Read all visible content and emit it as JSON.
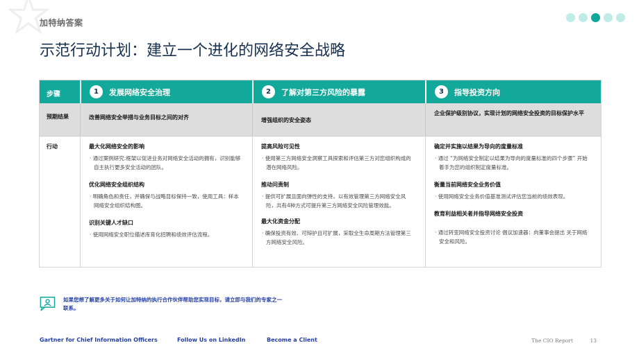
{
  "header": {
    "brand": "加特纳答案",
    "title": "示范行动计划：建立一个进化的网络安全战略",
    "nav_dots": 5,
    "active_dot": 2
  },
  "table": {
    "first_col_header": "步骤",
    "steps": [
      {
        "number": "1",
        "label": "发展网络安全治理"
      },
      {
        "number": "2",
        "label": "了解对第三方风险的暴露"
      },
      {
        "number": "3",
        "label": "指导投资方向"
      }
    ],
    "results_label": "预期结果",
    "results": [
      "改善网络安全举措与业务目标之间的对齐",
      "增强组织的安全姿态",
      "企业保护级别协议，实现计划的网络安全投资的目标保护水平"
    ],
    "actions_label": "行动",
    "actions": [
      {
        "items": [
          {
            "head": "最大化网络安全的影响",
            "body": "· 通过案例研究:框架以促进业务对网络安全活动的拥有，识别能够自主执行更多安全活动的团队。"
          },
          {
            "head": "优化网络安全组织结构",
            "body": "· 明确角色和责任，并确保与战略目标保持一致，使用工具：样本网络安全组织结构图。"
          },
          {
            "head": "识别关键人才缺口",
            "body": "· 使用网络安全职位描述库育化招聘和绩效评估流程。"
          }
        ]
      },
      {
        "items": [
          {
            "head": "提高风险可见性",
            "body": "· 使用第三方网络安全洞察工具探索和评估第三方对您组织构成的潜在网络风险。"
          },
          {
            "head": "推动问责制",
            "body": "· 提供可扩展且面向弹性的支持，以有效管理第三方网络安全风险，共有4种方式可提升第三方网络安全风险管理效能。"
          },
          {
            "head": "最大化资金分配",
            "body": "· 确保投资有效、可辩护且可扩展，采取全生命周期方法管理第三方网络安全风险。"
          }
        ]
      },
      {
        "items": [
          {
            "head": "确定并实施以结果为导向的度量标准",
            "body": "· 通过 “为网络安全制定以结果为导向的度量标准的四个步骤” 开始着手为您的组织制定度量标准。"
          },
          {
            "head": "衡量当前网络安全业务价值",
            "body": "· 使用网络安全业务价值基准测试评估您当前的绩效表现。"
          },
          {
            "head": "教育利益相关者并指导网络安全投资",
            "body": "· 通过转变网络安全投资讨论 倡议加速器：向董事会提出 关于网络安全和风险。"
          }
        ]
      }
    ]
  },
  "cta": {
    "text": "如果您想了解更多关于如何让加特纳的执行合作伙伴帮助您实现目标，请立即与我们的专家之一联系。"
  },
  "footer": {
    "link1": "Gartner for Chief Information Officers",
    "link2": "Follow Us on LinkedIn",
    "link3": "Become a Client",
    "report": "The CIO Report",
    "page": "13"
  },
  "colors": {
    "teal": "#12a99a",
    "navy": "#17304f",
    "link_blue": "#2440a6",
    "results_bg": "#dddddd"
  }
}
